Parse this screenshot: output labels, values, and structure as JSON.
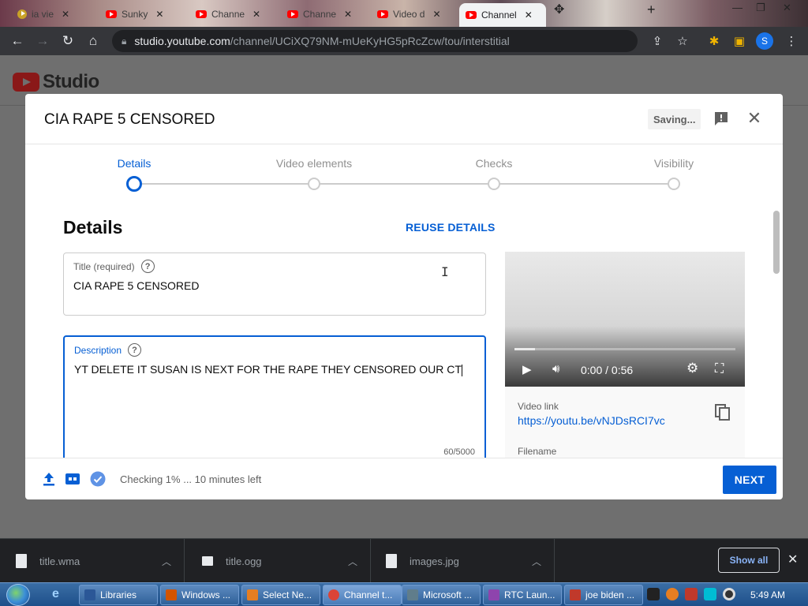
{
  "browser": {
    "tabs": [
      {
        "label": "ia vie",
        "active": false
      },
      {
        "label": "Sunky",
        "active": false
      },
      {
        "label": "Channe",
        "active": false
      },
      {
        "label": "Channe",
        "active": false
      },
      {
        "label": "Video d",
        "active": false
      },
      {
        "label": "Channel",
        "active": true
      }
    ],
    "new_tab_icon": "plus-icon",
    "url_host": "studio.youtube.com",
    "url_path": "/channel/UCiXQ79NM-mUeKyHG5pRcZcw/tou/interstitial",
    "profile_initial": "S"
  },
  "studio": {
    "logo_text": "Studio"
  },
  "dialog": {
    "title": "CIA RAPE 5 CENSORED",
    "saving_label": "Saving...",
    "steps": [
      {
        "label": "Details",
        "active": true
      },
      {
        "label": "Video elements",
        "active": false
      },
      {
        "label": "Checks",
        "active": false
      },
      {
        "label": "Visibility",
        "active": false
      }
    ],
    "section_heading": "Details",
    "reuse_label": "REUSE DETAILS",
    "title_field": {
      "label": "Title (required)",
      "value": "CIA RAPE 5 CENSORED"
    },
    "description_field": {
      "label": "Description",
      "value": "YT DELETE IT SUSAN IS NEXT FOR THE RAPE THEY CENSORED OUR CT",
      "counter": "60/5000"
    },
    "player": {
      "time": "0:00 / 0:56",
      "progress": 0.0
    },
    "video_link_label": "Video link",
    "video_link": "https://youtu.be/vNJDsRCI7vc",
    "filename_label": "Filename",
    "status_text": "Checking 1% ... 10 minutes left",
    "next_label": "NEXT"
  },
  "downloads": {
    "items": [
      "title.wma",
      "title.ogg",
      "images.jpg"
    ],
    "show_all_label": "Show all"
  },
  "taskbar": {
    "items": [
      {
        "label": "Libraries",
        "color": "#2b5797"
      },
      {
        "label": "Windows ...",
        "color": "#d35400"
      },
      {
        "label": "Select Ne...",
        "color": "#e67e22"
      },
      {
        "label": "Channel t...",
        "color": "#db4437"
      },
      {
        "label": "Microsoft ...",
        "color": "#607d8b"
      },
      {
        "label": "RTC Laun...",
        "color": "#8e44ad"
      },
      {
        "label": "joe biden ...",
        "color": "#c0392b"
      }
    ],
    "clock": "5:49 AM"
  }
}
